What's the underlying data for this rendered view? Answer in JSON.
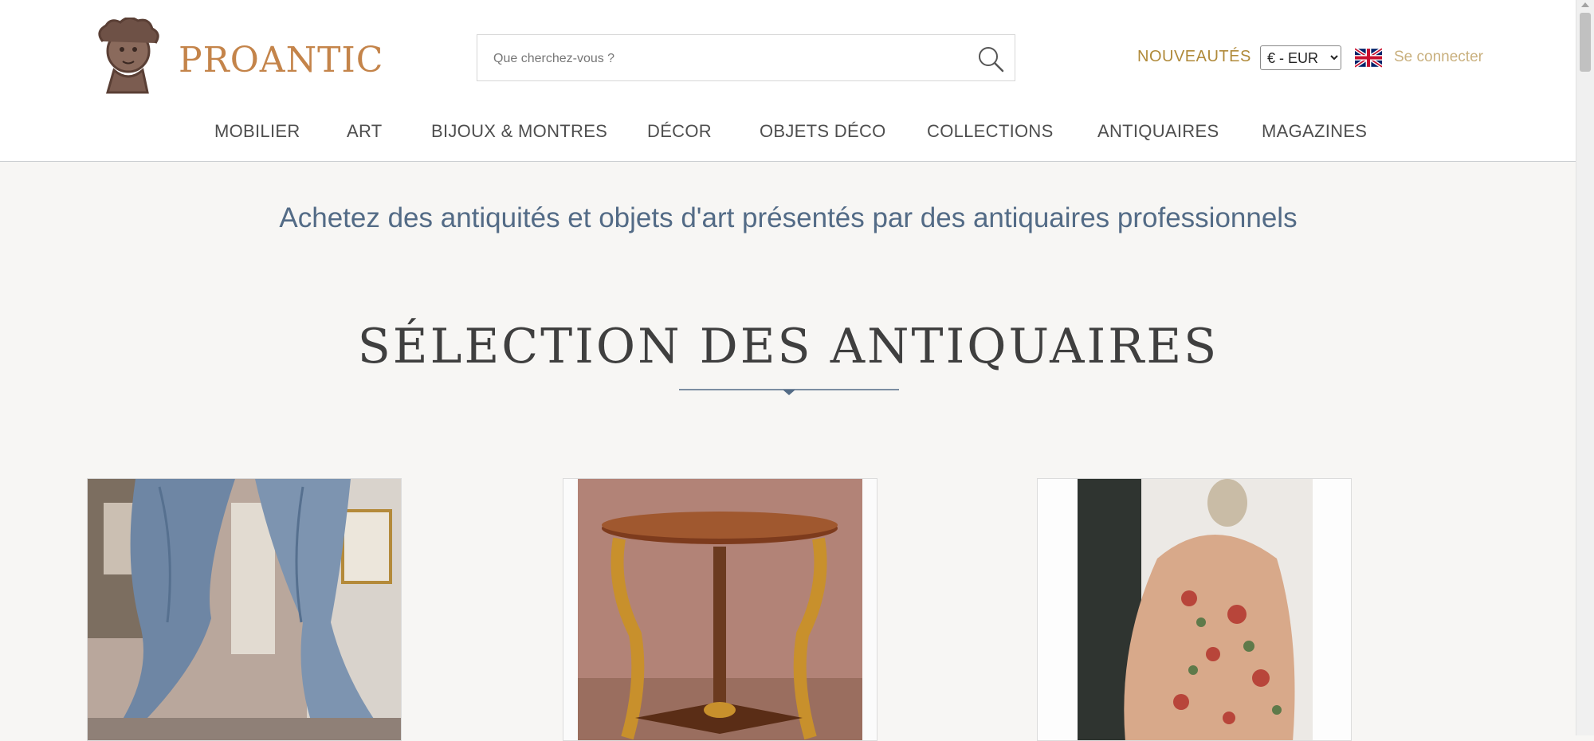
{
  "header": {
    "logo_text": "PROANTIC",
    "search": {
      "placeholder": "Que cherchez-vous ?",
      "value": ""
    },
    "nouveautes_label": "NOUVEAUTÉS",
    "currency": {
      "selected": "€ - EUR",
      "options": [
        "€ - EUR"
      ]
    },
    "login_label": "Se connecter"
  },
  "nav": {
    "items": [
      {
        "label": "MOBILIER"
      },
      {
        "label": "ART"
      },
      {
        "label": "BIJOUX & MONTRES"
      },
      {
        "label": "DÉCOR"
      },
      {
        "label": "OBJETS DÉCO"
      },
      {
        "label": "COLLECTIONS"
      },
      {
        "label": "ANTIQUAIRES"
      },
      {
        "label": "MAGAZINES"
      }
    ]
  },
  "main": {
    "tagline": "Achetez des antiquités et objets d'art présentés par des antiquaires professionnels",
    "section_title": "SÉLECTION DES ANTIQUAIRES",
    "products": [
      {
        "image": "blue-curtains-photo"
      },
      {
        "image": "gilded-gueridon-table-photo"
      },
      {
        "image": "floral-fabric-drape-photo"
      }
    ]
  },
  "colors": {
    "brand": "#c4844a",
    "nouveautes": "#b08a3a",
    "login": "#c9b07e",
    "tagline": "#536b86",
    "nav_text": "#4e4e4e",
    "background": "#f7f6f4"
  },
  "icons": {
    "search": "search-icon",
    "flag": "uk-flag-icon",
    "logo": "logo-bust-icon"
  }
}
